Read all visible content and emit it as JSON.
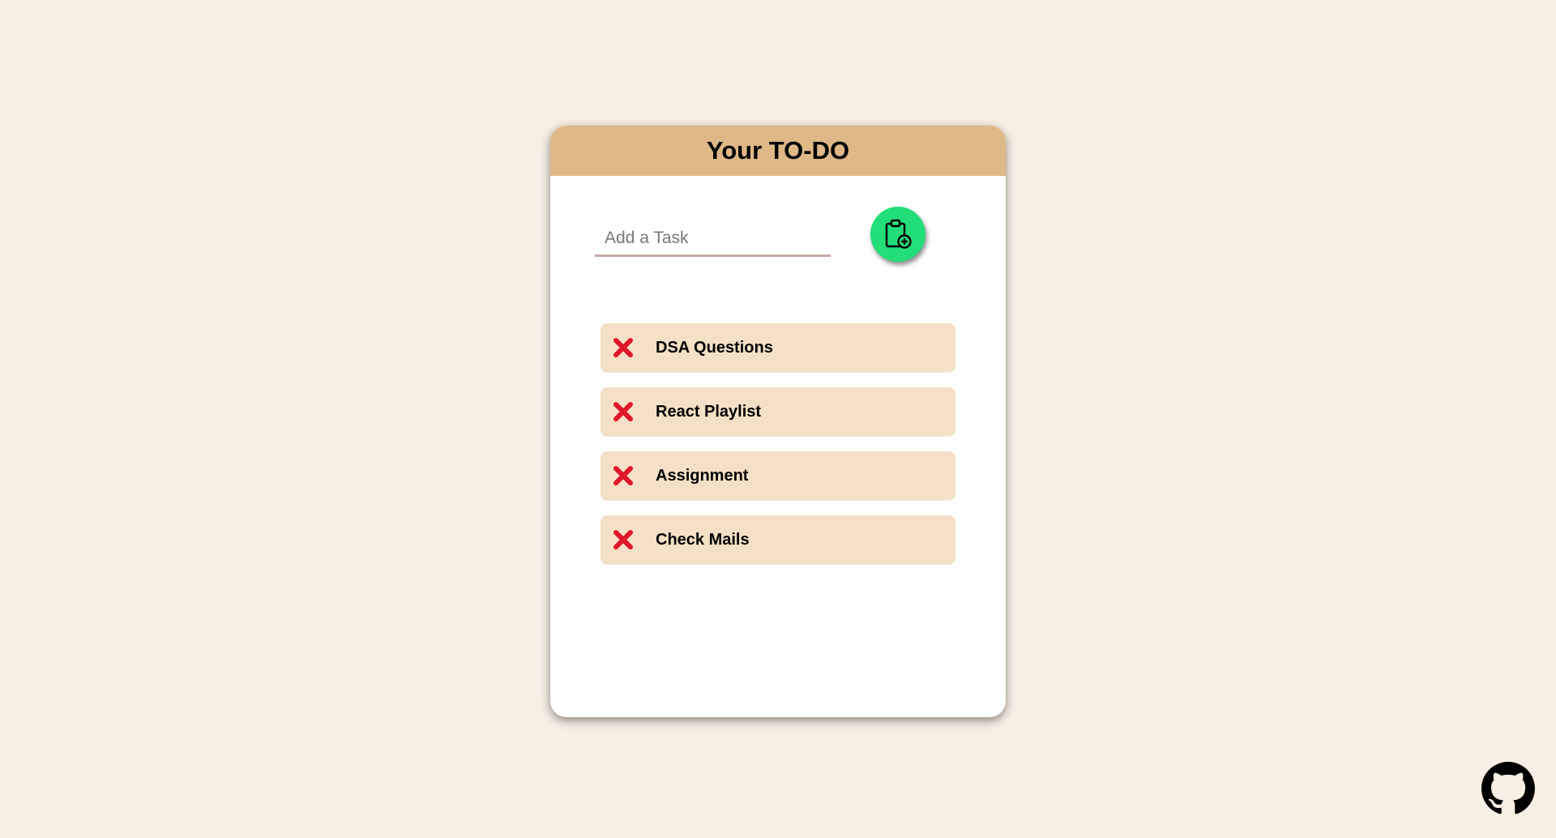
{
  "app": {
    "title": "Your TO-DO"
  },
  "input": {
    "placeholder": "Add a Task",
    "value": ""
  },
  "add_button": {
    "icon": "clipboard-plus-icon"
  },
  "tasks": [
    {
      "label": "DSA Questions",
      "icon": "red-cross-delete-icon"
    },
    {
      "label": "React Playlist",
      "icon": "red-cross-delete-icon"
    },
    {
      "label": "Assignment",
      "icon": "red-cross-delete-icon"
    },
    {
      "label": "Check Mails",
      "icon": "red-cross-delete-icon"
    }
  ],
  "footer": {
    "icon": "github-icon"
  },
  "colors": {
    "page_background": "#f7efe4",
    "header_background": "#deb887",
    "task_background": "#f4e0c6",
    "add_button": "#22de78",
    "delete_icon": "#e0162b"
  }
}
